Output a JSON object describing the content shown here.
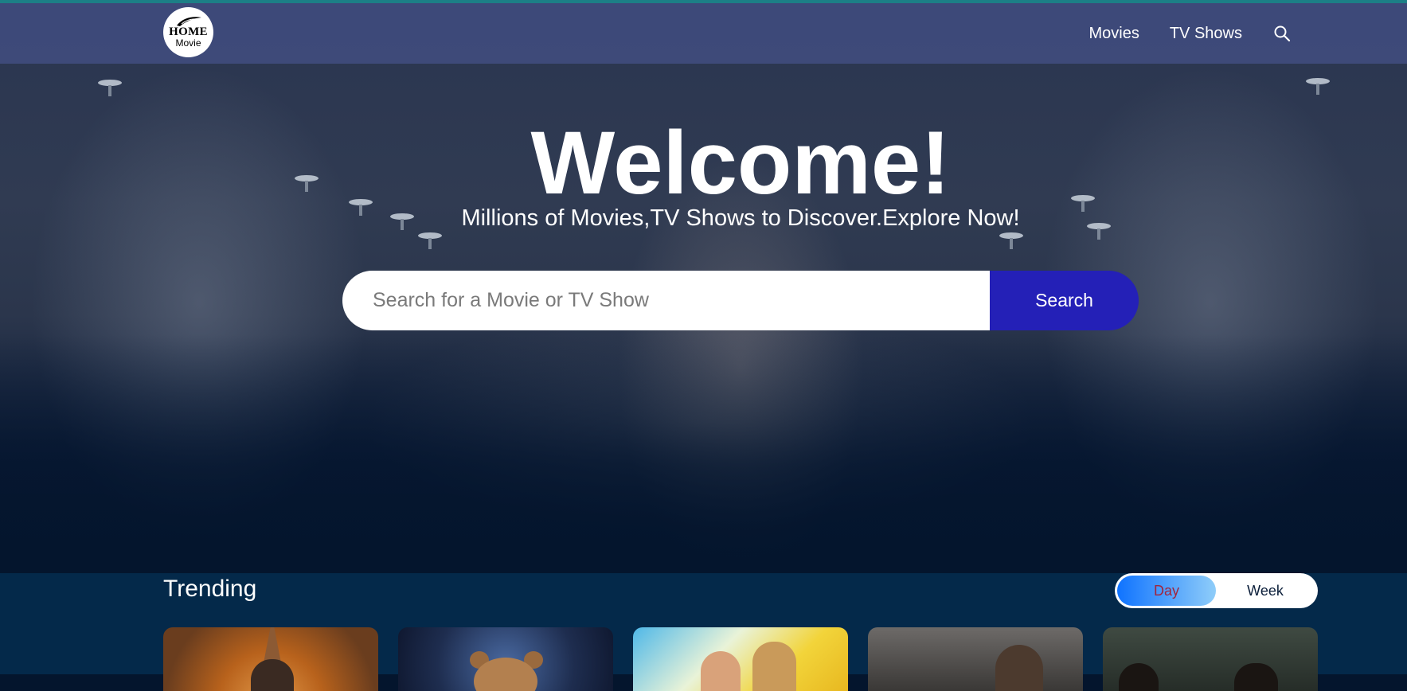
{
  "nav": {
    "logo_top": "HOME",
    "logo_bottom": "Movie",
    "links": [
      {
        "label": "Movies"
      },
      {
        "label": "TV Shows"
      }
    ],
    "search_icon": "search-icon"
  },
  "hero": {
    "title": "Welcome!",
    "subtitle": "Millions of Movies,TV Shows to Discover.Explore Now!",
    "search_placeholder": "Search for a Movie or TV Show",
    "search_button": "Search"
  },
  "trending": {
    "title": "Trending",
    "toggle": {
      "options": [
        "Day",
        "Week"
      ],
      "selected": "Day"
    },
    "card_count": 5
  },
  "colors": {
    "navbar": "#424e82",
    "search_button": "#2420b7",
    "background": "#04152d",
    "trending_background": "#04294a",
    "toggle_active_start": "#0f73ff",
    "toggle_active_end": "#8fcdf9"
  }
}
